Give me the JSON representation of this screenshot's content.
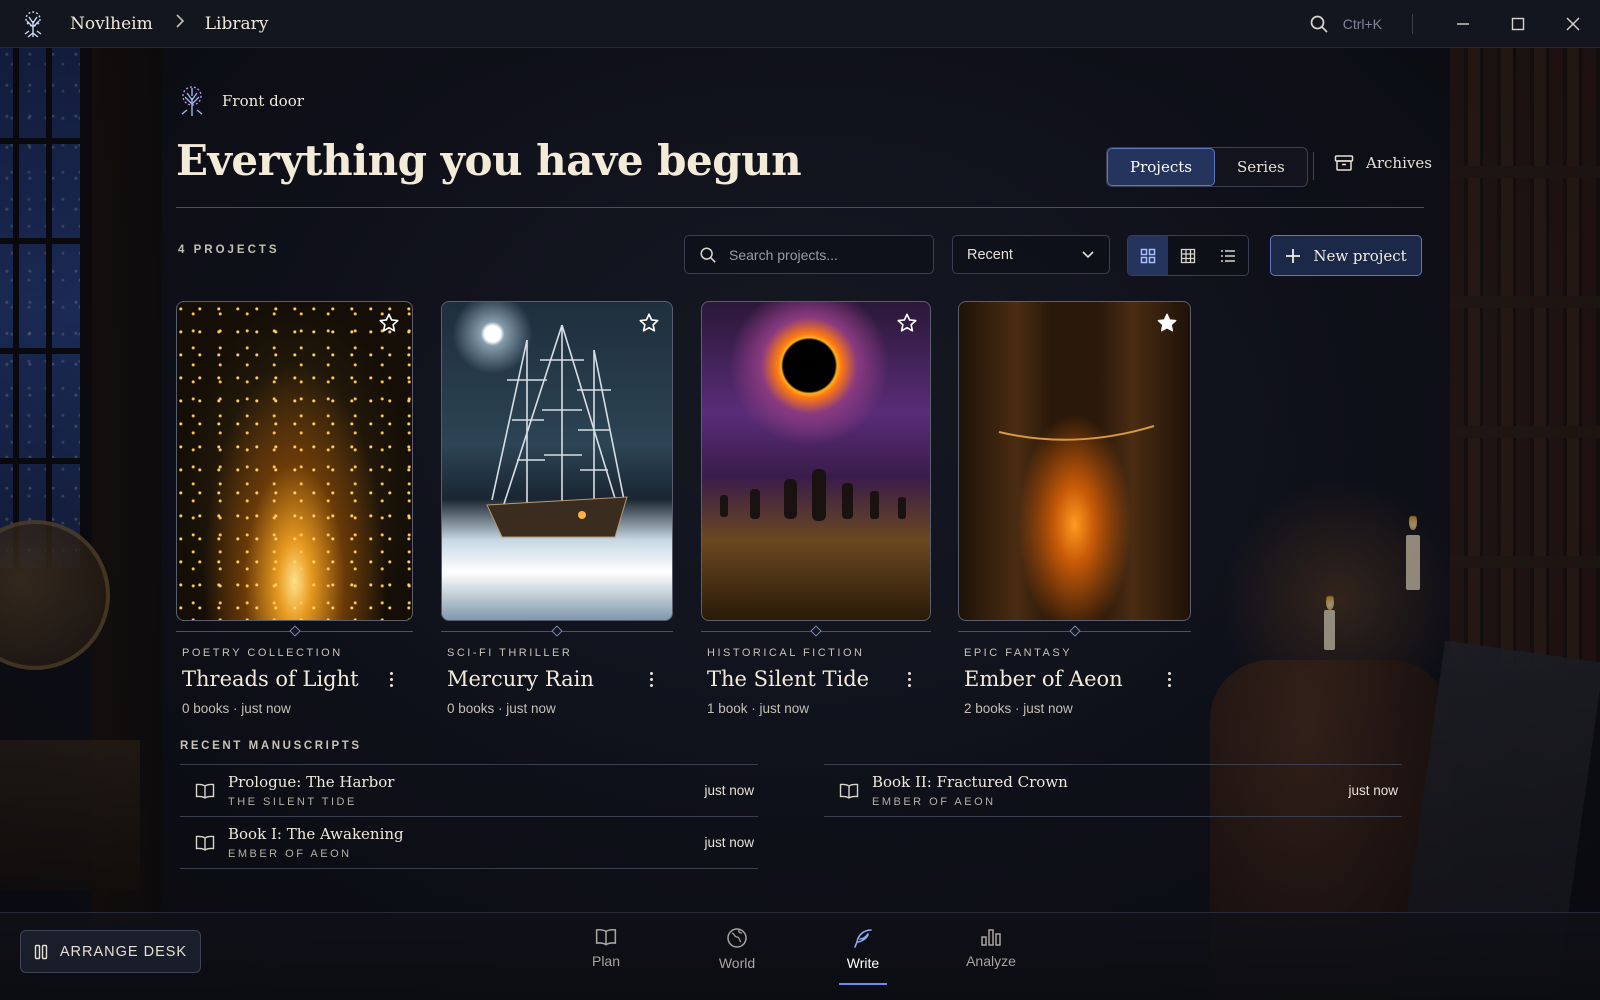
{
  "app": {
    "name": "Novlheim",
    "breadcrumb": "Library"
  },
  "titlebar": {
    "search_shortcut": "Ctrl+K",
    "icons": [
      "search-icon",
      "minimize-icon",
      "maximize-icon",
      "close-icon"
    ]
  },
  "header": {
    "eyebrow": "Front door",
    "title": "Everything you have begun",
    "tabs": [
      {
        "label": "Projects",
        "active": true
      },
      {
        "label": "Series",
        "active": false
      }
    ],
    "archives_label": "Archives"
  },
  "toolbar": {
    "count_label": "4 PROJECTS",
    "search_placeholder": "Search projects...",
    "sort_value": "Recent",
    "view_modes": [
      "grid-large",
      "grid-small",
      "list"
    ],
    "active_view": "grid-large",
    "new_project_label": "New project"
  },
  "projects": [
    {
      "genre": "POETRY COLLECTION",
      "title": "Threads of Light",
      "meta": "0 books · just now",
      "starred": false,
      "cover": "golden starfield over sea"
    },
    {
      "genre": "SCI-FI THRILLER",
      "title": "Mercury Rain",
      "meta": "0 books · just now",
      "starred": false,
      "cover": "tall ship in ice under moon"
    },
    {
      "genre": "HISTORICAL FICTION",
      "title": "The Silent Tide",
      "meta": "1 book · just now",
      "starred": false,
      "cover": "eclipse over standing stones"
    },
    {
      "genre": "EPIC FANTASY",
      "title": "Ember of Aeon",
      "meta": "2 books · just now",
      "starred": true,
      "cover": "glowing canyon path"
    }
  ],
  "recent": {
    "label": "RECENT MANUSCRIPTS",
    "items": [
      {
        "title": "Prologue: The Harbor",
        "project": "THE SILENT TIDE",
        "when": "just now"
      },
      {
        "title": "Book I: The Awakening",
        "project": "EMBER OF AEON",
        "when": "just now"
      },
      {
        "title": "Book II: Fractured Crown",
        "project": "EMBER OF AEON",
        "when": "just now"
      }
    ]
  },
  "bottom": {
    "arrange_label": "ARRANGE DESK",
    "nav": [
      {
        "label": "Plan",
        "icon": "book-open-icon",
        "active": false
      },
      {
        "label": "World",
        "icon": "globe-icon",
        "active": false
      },
      {
        "label": "Write",
        "icon": "quill-icon",
        "active": true
      },
      {
        "label": "Analyze",
        "icon": "bar-chart-icon",
        "active": false
      }
    ]
  },
  "colors": {
    "accent": "#5b78c0",
    "accent_fill": "#24345c",
    "text": "#efe8da"
  }
}
